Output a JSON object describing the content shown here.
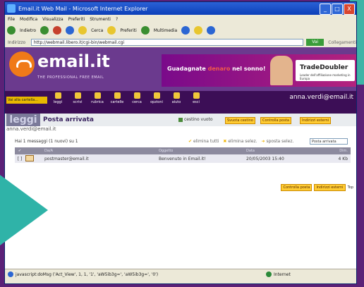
{
  "window": {
    "title": "Email.it Web Mail - Microsoft Internet Explorer",
    "min": "_",
    "max": "□",
    "close": "X"
  },
  "menu": [
    "File",
    "Modifica",
    "Visualizza",
    "Preferiti",
    "Strumenti",
    "?"
  ],
  "toolbar": {
    "back": "Indietro",
    "search": "Cerca",
    "favorites": "Preferiti",
    "multimedia": "Multimedia"
  },
  "address": {
    "label": "Indirizzo",
    "url": "http://webmail.libero.it/cgi-bin/webmail.cgi",
    "go": "Vai",
    "links": "Collegamenti"
  },
  "brand": {
    "name": "email.it",
    "tagline": "THE PROFESSIONAL FREE EMAIL"
  },
  "banner": {
    "text_a": "Guadagnate ",
    "text_hl": "denaro",
    "text_b": " nel sonno!",
    "partner": "TradeDoubler",
    "partner_sub": "Leader dell'affiliazione marketing in Europa"
  },
  "nav": {
    "dropdown": "Vai alla cartella...",
    "items": [
      "leggi",
      "scrivi",
      "rubrica",
      "cartelle",
      "cerca",
      "opzioni",
      "aiuto",
      "esci"
    ],
    "user": "anna.verdi@email.it"
  },
  "section": {
    "leggi": "leggi",
    "title": "Posta arrivata",
    "cestino": "cestino vuoto",
    "btn_svuota": "Svuota cestino",
    "btn_controlla": "Controlla posta",
    "btn_indirizzi": "Indirizzi esterni"
  },
  "user_email": "anna.verdi@email.it",
  "messages": {
    "count": "Hai 1 messaggi (1 nuovi) su 1",
    "actions": [
      "elimina tutti",
      "elimina selez.",
      "sposta selez."
    ],
    "folder": "Posta arrivata",
    "columns": [
      "Da/A",
      "Oggetto",
      "Data",
      "Dim."
    ],
    "rows": [
      {
        "from": "postmaster@email.it",
        "subject": "Benvenuto in Email.it!",
        "date": "20/05/2003 15:40",
        "size": "4 Kb"
      }
    ]
  },
  "bottom": {
    "btn_controlla": "Controlla posta",
    "btn_indirizzi": "Indirizzi esterni",
    "top": "Top"
  },
  "status": {
    "text": "javascript:doMsg ('Act_View', 1, 1, '1', 'aW5ib3g=', 'aW5ib3g=', '0')",
    "zone": "Internet"
  }
}
